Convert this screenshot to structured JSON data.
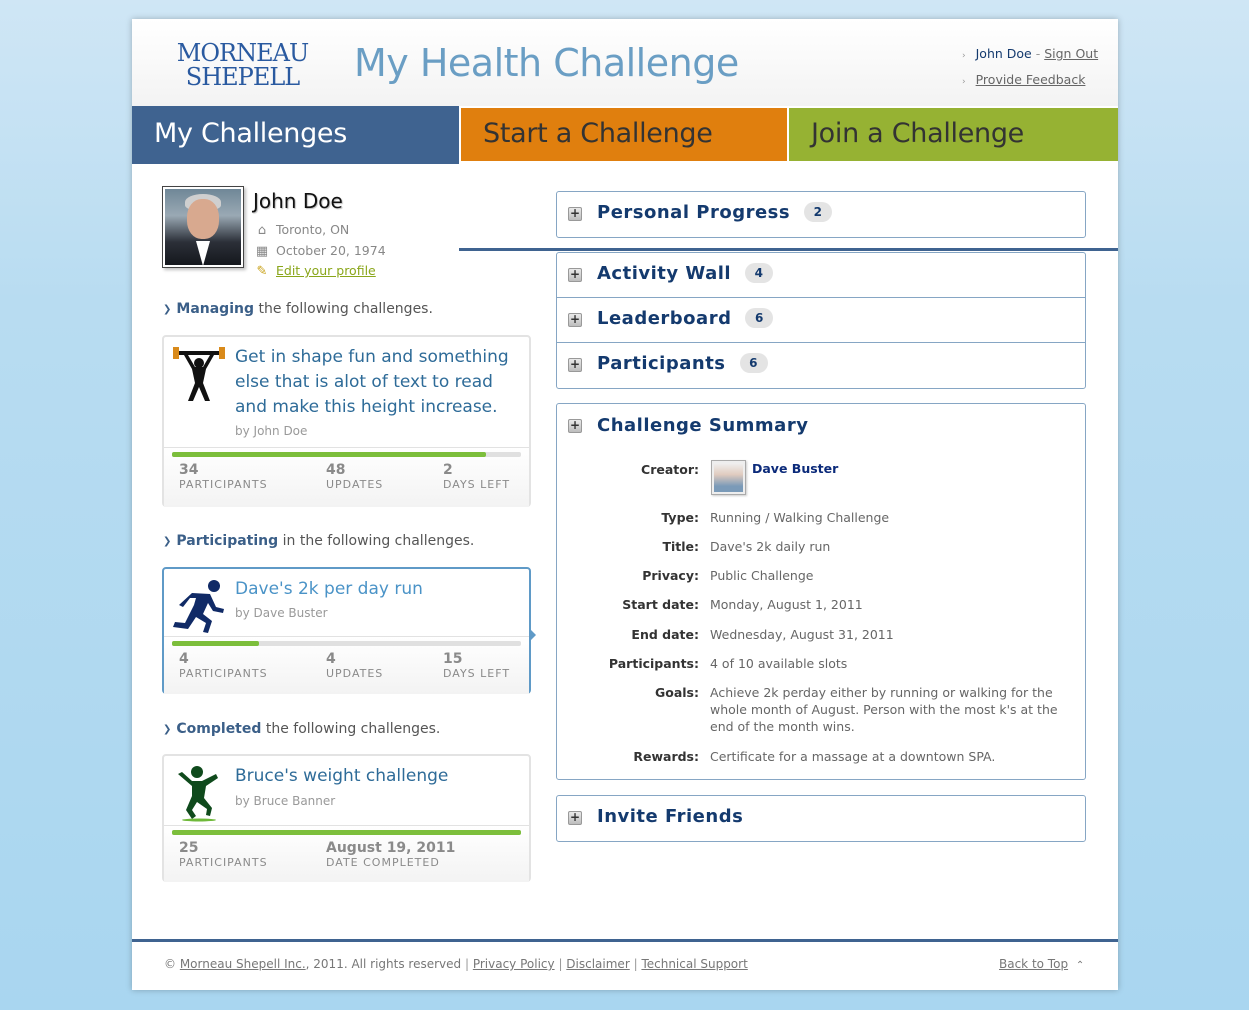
{
  "header": {
    "logo_line1": "MORNEAU",
    "logo_line2": "SHEPELL",
    "title": "My Health Challenge",
    "user_name": "John Doe",
    "sign_out": "Sign Out",
    "feedback": "Provide Feedback"
  },
  "tabs": [
    "My Challenges",
    "Start a Challenge",
    "Join a Challenge"
  ],
  "profile": {
    "name": "John Doe",
    "location": "Toronto, ON",
    "birthdate": "October 20, 1974",
    "edit": "Edit your profile"
  },
  "sections": {
    "managing_bold": "Managing",
    "managing_rest": " the following challenges.",
    "participating_bold": "Participating",
    "participating_rest": " in the following challenges.",
    "completed_bold": "Completed",
    "completed_rest": " the following challenges."
  },
  "cards": {
    "managing": {
      "title": "Get in shape fun and something else that is alot of text to read and make this height increase.",
      "by": "by John Doe",
      "progress": 0.9,
      "s1_n": "34",
      "s1_l": "PARTICIPANTS",
      "s2_n": "48",
      "s2_l": "UPDATES",
      "s3_n": "2",
      "s3_l": "DAYS LEFT"
    },
    "participating": {
      "title": "Dave's 2k per day run",
      "by": "by Dave Buster",
      "progress": 0.25,
      "s1_n": "4",
      "s1_l": "PARTICIPANTS",
      "s2_n": "4",
      "s2_l": "UPDATES",
      "s3_n": "15",
      "s3_l": "DAYS LEFT"
    },
    "completed": {
      "title": "Bruce's weight challenge",
      "by": "by Bruce Banner",
      "progress": 1.0,
      "s1_n": "25",
      "s1_l": "PARTICIPANTS",
      "s2_n": "August 19, 2011",
      "s2_l": "DATE COMPLETED"
    }
  },
  "panels": {
    "personal_progress": "Personal Progress",
    "personal_progress_count": "2",
    "activity_wall": "Activity Wall",
    "activity_wall_count": "4",
    "leaderboard": "Leaderboard",
    "leaderboard_count": "6",
    "participants": "Participants",
    "participants_count": "6",
    "summary": "Challenge Summary",
    "invite": "Invite Friends"
  },
  "summary": {
    "creator_k": "Creator:",
    "creator_v": "Dave Buster",
    "type_k": "Type:",
    "type_v": "Running / Walking Challenge",
    "title_k": "Title:",
    "title_v": "Dave's 2k daily run",
    "privacy_k": "Privacy:",
    "privacy_v": "Public Challenge",
    "start_k": "Start date:",
    "start_v": "Monday, August 1, 2011",
    "end_k": "End date:",
    "end_v": "Wednesday, August 31, 2011",
    "participants_k": "Participants:",
    "participants_v": "4 of 10 available slots",
    "goals_k": "Goals:",
    "goals_v": "Achieve 2k perday either by running or walking for the whole month of August. Person with the most k's at the end of the month wins.",
    "rewards_k": "Rewards:",
    "rewards_v": "Certificate for a massage at a downtown SPA."
  },
  "footer": {
    "copy": "© ",
    "company": "Morneau Shepell Inc.",
    "rights": ", 2011. All rights reserved",
    "privacy": "Privacy Policy",
    "disclaimer": "Disclaimer",
    "support": "Technical Support",
    "back_to_top": "Back to Top"
  },
  "colors": {
    "tab_blue": "#3f6390",
    "tab_orange": "#e07f0e",
    "tab_green": "#96b233",
    "progress_green": "#7cbe3b"
  }
}
